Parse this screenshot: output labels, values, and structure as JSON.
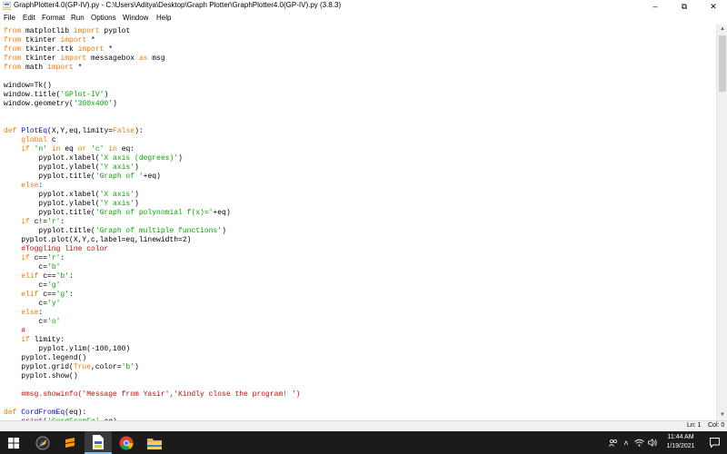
{
  "window": {
    "title": "GraphPlotter4.0(GP-IV).py - C:\\Users\\Aditya\\Desktop\\Graph Plotter\\GraphPlotter4.0(GP-IV).py (3.8.3)",
    "minimize_icon": "–",
    "maximize_icon": "⧉",
    "close_icon": "✕"
  },
  "menu": [
    "File",
    "Edit",
    "Format",
    "Run",
    "Options",
    "Window",
    "Help"
  ],
  "colors": {
    "keyword": "#ff7700",
    "builtin": "#900090",
    "string": "#00aa00",
    "comment": "#dd0000",
    "definition": "#0000ff",
    "plain": "#000000"
  },
  "code_lines": [
    [
      [
        "kw",
        "from"
      ],
      [
        "t",
        " matplotlib "
      ],
      [
        "kw",
        "import"
      ],
      [
        "t",
        " pyplot"
      ]
    ],
    [
      [
        "kw",
        "from"
      ],
      [
        "t",
        " tkinter "
      ],
      [
        "kw",
        "import"
      ],
      [
        "t",
        " *"
      ]
    ],
    [
      [
        "kw",
        "from"
      ],
      [
        "t",
        " tkinter.ttk "
      ],
      [
        "kw",
        "import"
      ],
      [
        "t",
        " *"
      ]
    ],
    [
      [
        "kw",
        "from"
      ],
      [
        "t",
        " tkinter "
      ],
      [
        "kw",
        "import"
      ],
      [
        "t",
        " messagebox "
      ],
      [
        "kw",
        "as"
      ],
      [
        "t",
        " msg"
      ]
    ],
    [
      [
        "kw",
        "from"
      ],
      [
        "t",
        " math "
      ],
      [
        "kw",
        "import"
      ],
      [
        "t",
        " *"
      ]
    ],
    [],
    [
      [
        "t",
        "window=Tk()"
      ]
    ],
    [
      [
        "t",
        "window.title("
      ],
      [
        "str",
        "'GPlot-IV'"
      ],
      [
        "t",
        ")"
      ]
    ],
    [
      [
        "t",
        "window.geometry("
      ],
      [
        "str",
        "'300x400'"
      ],
      [
        "t",
        ")"
      ]
    ],
    [],
    [],
    [
      [
        "kw",
        "def"
      ],
      [
        "t",
        " "
      ],
      [
        "def",
        "PlotEq"
      ],
      [
        "t",
        "(X,Y,eq,limity="
      ],
      [
        "kw",
        "False"
      ],
      [
        "t",
        "):"
      ]
    ],
    [
      [
        "t",
        "    "
      ],
      [
        "kw",
        "global"
      ],
      [
        "t",
        " c"
      ]
    ],
    [
      [
        "t",
        "    "
      ],
      [
        "kw",
        "if"
      ],
      [
        "t",
        " "
      ],
      [
        "str",
        "'n'"
      ],
      [
        "t",
        " "
      ],
      [
        "kw",
        "in"
      ],
      [
        "t",
        " eq "
      ],
      [
        "kw",
        "or"
      ],
      [
        "t",
        " "
      ],
      [
        "str",
        "'c'"
      ],
      [
        "t",
        " "
      ],
      [
        "kw",
        "in"
      ],
      [
        "t",
        " eq:"
      ]
    ],
    [
      [
        "t",
        "        pyplot.xlabel("
      ],
      [
        "str",
        "'X axis (degrees)'"
      ],
      [
        "t",
        ")"
      ]
    ],
    [
      [
        "t",
        "        pyplot.ylabel("
      ],
      [
        "str",
        "'Y axis'"
      ],
      [
        "t",
        ")"
      ]
    ],
    [
      [
        "t",
        "        pyplot.title("
      ],
      [
        "str",
        "'Graph of '"
      ],
      [
        "t",
        "+eq)"
      ]
    ],
    [
      [
        "t",
        "    "
      ],
      [
        "kw",
        "else"
      ],
      [
        "t",
        ":"
      ]
    ],
    [
      [
        "t",
        "        pyplot.xlabel("
      ],
      [
        "str",
        "'X axis'"
      ],
      [
        "t",
        ")"
      ]
    ],
    [
      [
        "t",
        "        pyplot.ylabel("
      ],
      [
        "str",
        "'Y axis'"
      ],
      [
        "t",
        ")"
      ]
    ],
    [
      [
        "t",
        "        pyplot.title("
      ],
      [
        "str",
        "'Graph of polynomial f(x)='"
      ],
      [
        "t",
        "+eq)"
      ]
    ],
    [
      [
        "t",
        "    "
      ],
      [
        "kw",
        "if"
      ],
      [
        "t",
        " c!="
      ],
      [
        "str",
        "'r'"
      ],
      [
        "t",
        ":"
      ]
    ],
    [
      [
        "t",
        "        pyplot.title("
      ],
      [
        "str",
        "'Graph of multiple functions'"
      ],
      [
        "t",
        ")"
      ]
    ],
    [
      [
        "t",
        "    pyplot.plot(X,Y,c,label=eq,linewidth=2)"
      ]
    ],
    [
      [
        "t",
        "    "
      ],
      [
        "com",
        "#Toggling line color"
      ]
    ],
    [
      [
        "t",
        "    "
      ],
      [
        "kw",
        "if"
      ],
      [
        "t",
        " c=="
      ],
      [
        "str",
        "'r'"
      ],
      [
        "t",
        ":"
      ]
    ],
    [
      [
        "t",
        "        c="
      ],
      [
        "str",
        "'b'"
      ]
    ],
    [
      [
        "t",
        "    "
      ],
      [
        "kw",
        "elif"
      ],
      [
        "t",
        " c=="
      ],
      [
        "str",
        "'b'"
      ],
      [
        "t",
        ":"
      ]
    ],
    [
      [
        "t",
        "        c="
      ],
      [
        "str",
        "'g'"
      ]
    ],
    [
      [
        "t",
        "    "
      ],
      [
        "kw",
        "elif"
      ],
      [
        "t",
        " c=="
      ],
      [
        "str",
        "'g'"
      ],
      [
        "t",
        ":"
      ]
    ],
    [
      [
        "t",
        "        c="
      ],
      [
        "str",
        "'y'"
      ]
    ],
    [
      [
        "t",
        "    "
      ],
      [
        "kw",
        "else"
      ],
      [
        "t",
        ":"
      ]
    ],
    [
      [
        "t",
        "        c="
      ],
      [
        "str",
        "'o'"
      ]
    ],
    [
      [
        "t",
        "    "
      ],
      [
        "com",
        "#"
      ]
    ],
    [
      [
        "t",
        "    "
      ],
      [
        "kw",
        "if"
      ],
      [
        "t",
        " limity:"
      ]
    ],
    [
      [
        "t",
        "        pyplot.ylim(-100,100)"
      ]
    ],
    [
      [
        "t",
        "    pyplot.legend()"
      ]
    ],
    [
      [
        "t",
        "    pyplot.grid("
      ],
      [
        "kw",
        "True"
      ],
      [
        "t",
        ",color="
      ],
      [
        "str",
        "'b'"
      ],
      [
        "t",
        ")"
      ]
    ],
    [
      [
        "t",
        "    pyplot.show()"
      ]
    ],
    [],
    [
      [
        "t",
        "    "
      ],
      [
        "com",
        "#msg.showinfo('Message from Yasir','Kindly close the program! ')"
      ]
    ],
    [],
    [
      [
        "kw",
        "def"
      ],
      [
        "t",
        " "
      ],
      [
        "def",
        "CordFromEq"
      ],
      [
        "t",
        "(eq):"
      ]
    ],
    [
      [
        "t",
        "    "
      ],
      [
        "bi",
        "print"
      ],
      [
        "t",
        "("
      ],
      [
        "str",
        "'CordFromEq'"
      ],
      [
        "t",
        ",eq)"
      ]
    ]
  ],
  "status": {
    "line": "Ln: 1",
    "col": "Col: 0"
  },
  "taskbar": {
    "time": "11:44 AM",
    "date": "1/19/2021"
  }
}
